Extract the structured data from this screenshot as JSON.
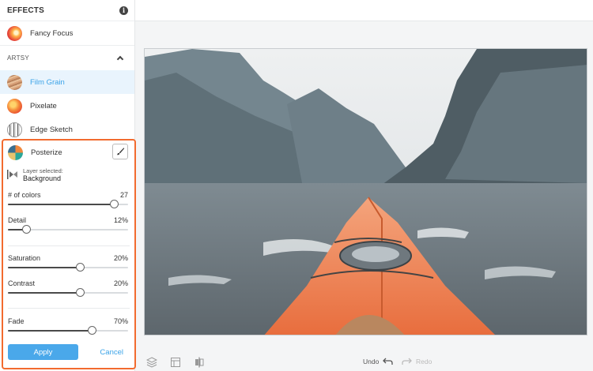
{
  "sidebar": {
    "title": "EFFECTS",
    "info_icon": "i",
    "top_effect": {
      "label": "Fancy Focus",
      "icon": "fancy-focus-thumbnail"
    },
    "section": {
      "title": "ARTSY"
    },
    "items": [
      {
        "label": "Film Grain",
        "icon": "film-grain-thumbnail",
        "active": true
      },
      {
        "label": "Pixelate",
        "icon": "pixelate-thumbnail"
      },
      {
        "label": "Edge Sketch",
        "icon": "edge-sketch-thumbnail"
      }
    ]
  },
  "panel": {
    "effect_label": "Posterize",
    "layer_label": "Layer selected:",
    "layer_value": "Background",
    "controls": {
      "colors": {
        "label": "# of colors",
        "value": "27",
        "level": 0.88
      },
      "detail": {
        "label": "Detail",
        "value": "12%",
        "level": 0.15
      },
      "saturation": {
        "label": "Saturation",
        "value": "20%",
        "level": 0.6
      },
      "contrast": {
        "label": "Contrast",
        "value": "20%",
        "level": 0.6
      },
      "fade": {
        "label": "Fade",
        "value": "70%",
        "level": 0.7
      }
    },
    "apply_label": "Apply",
    "cancel_label": "Cancel",
    "accent_color": "#f26b2f",
    "button_color": "#4aa8ea"
  },
  "toolbar": {
    "undo_label": "Undo",
    "redo_label": "Redo",
    "icons": [
      "layers-icon",
      "crop-frame-icon",
      "compare-icon"
    ]
  }
}
